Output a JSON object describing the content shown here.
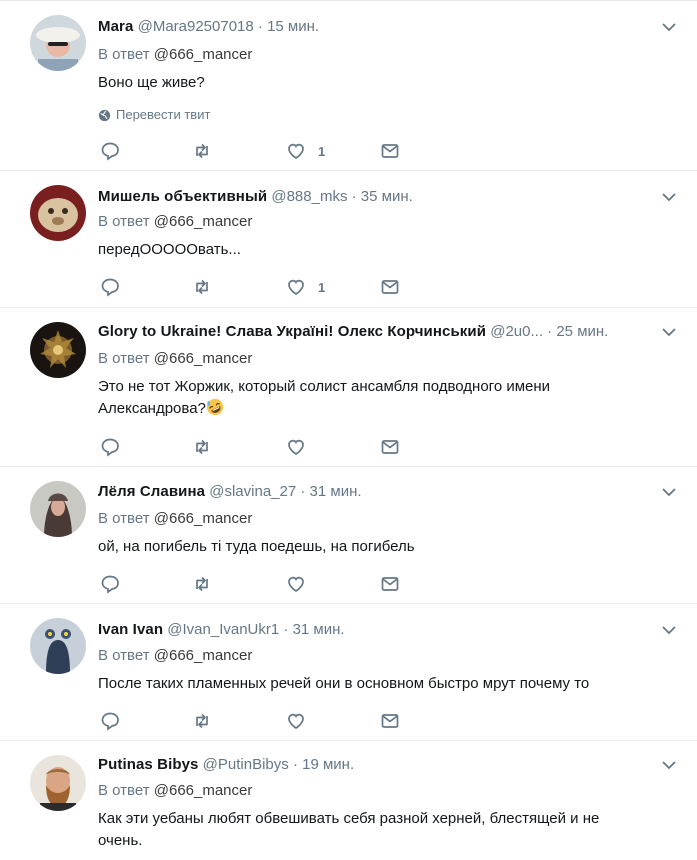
{
  "tweets": [
    {
      "fullname": "Mara",
      "handle": "@Mara92507018",
      "dot": "·",
      "time": "15 мин.",
      "reply_prefix": "В ответ",
      "reply_to": "@666_mancer",
      "text": "Воно ще живе?",
      "translate": "Перевести твит",
      "like_count": "1"
    },
    {
      "fullname": "Мишель объективный",
      "handle": "@888_mks",
      "dot": "·",
      "time": "35 мин.",
      "reply_prefix": "В ответ",
      "reply_to": "@666_mancer",
      "text": "передОООООвать...",
      "like_count": "1"
    },
    {
      "fullname": "Glory to Ukraine! Слава Україні! Олекс Корчинський",
      "handle": "@2u0...",
      "dot": "·",
      "time": "25 мин.",
      "reply_prefix": "В ответ",
      "reply_to": "@666_mancer",
      "text_line1": "Это не тот Жоржик, который солист ансамбля подводного имени",
      "text_line2": "Александрова?",
      "emoji": "rolling-on-floor-laughing-emoji",
      "like_count": ""
    },
    {
      "fullname": "Лёля Славина",
      "handle": "@slavina_27",
      "dot": "·",
      "time": "31 мин.",
      "reply_prefix": "В ответ",
      "reply_to": "@666_mancer",
      "text": "ой, на погибель ті туда поедешь, на погибель",
      "like_count": ""
    },
    {
      "fullname": "Ivan Ivan",
      "handle": "@Ivan_IvanUkr1",
      "dot": "·",
      "time": "31 мин.",
      "reply_prefix": "В ответ",
      "reply_to": "@666_mancer",
      "text": "После таких пламенных речей они в основном быстро мрут почему то",
      "like_count": ""
    },
    {
      "fullname": "Putinas Bibys",
      "handle": "@PutinBibys",
      "dot": "·",
      "time": "19 мин.",
      "reply_prefix": "В ответ",
      "reply_to": "@666_mancer",
      "text_line1": "Как эти уебаны любят обвешивать себя разной херней, блестящей и не",
      "text_line2": "очень."
    }
  ],
  "colors": {
    "secondary_text": "#657786",
    "divider": "#e6ecf0",
    "primary_text": "#14171a",
    "icon": "#657786"
  },
  "icons": [
    "reply-icon",
    "retweet-icon",
    "like-icon",
    "direct-message-icon",
    "chevron-down-icon",
    "globe-icon"
  ]
}
